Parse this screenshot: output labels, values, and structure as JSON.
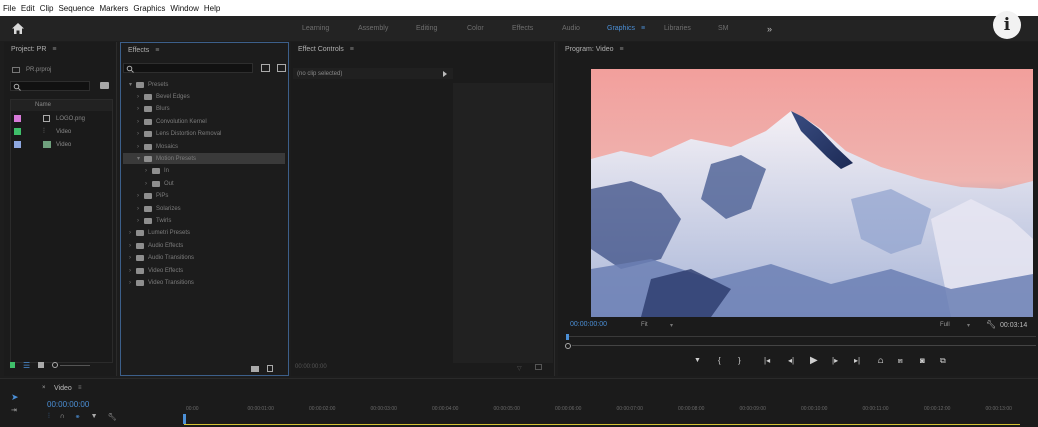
{
  "menubar": [
    "File",
    "Edit",
    "Clip",
    "Sequence",
    "Markers",
    "Graphics",
    "Window",
    "Help"
  ],
  "workspaces": {
    "tabs": [
      "Learning",
      "Assembly",
      "Editing",
      "Color",
      "Effects",
      "Audio",
      "Graphics",
      "Libraries",
      "SM"
    ],
    "active": "Graphics",
    "more": "»"
  },
  "info_button": "i",
  "project": {
    "title": "Project: PR",
    "file": "PR.prproj",
    "column_name": "Name",
    "items": [
      {
        "name": "LOGO.png",
        "color": "#d77ad9"
      },
      {
        "name": "Video",
        "color": "#3fbf6a"
      },
      {
        "name": "Video",
        "color": "#8ea8e0"
      }
    ]
  },
  "effects": {
    "title": "Effects",
    "tree": [
      {
        "label": "Presets",
        "level": 0
      },
      {
        "label": "Bevel Edges",
        "level": 1
      },
      {
        "label": "Blurs",
        "level": 1
      },
      {
        "label": "Convolution Kernel",
        "level": 1
      },
      {
        "label": "Lens Distortion Removal",
        "level": 1
      },
      {
        "label": "Mosaics",
        "level": 1
      },
      {
        "label": "Motion Presets",
        "level": 1,
        "selected": true
      },
      {
        "label": "In",
        "level": 2
      },
      {
        "label": "Out",
        "level": 2
      },
      {
        "label": "PiPs",
        "level": 1
      },
      {
        "label": "Solarizes",
        "level": 1
      },
      {
        "label": "Twirls",
        "level": 1
      },
      {
        "label": "Lumetri Presets",
        "level": 0
      },
      {
        "label": "Audio Effects",
        "level": 0
      },
      {
        "label": "Audio Transitions",
        "level": 0
      },
      {
        "label": "Video Effects",
        "level": 0
      },
      {
        "label": "Video Transitions",
        "level": 0
      }
    ]
  },
  "effect_controls": {
    "title": "Effect Controls",
    "no_clip": "(no clip selected)",
    "footer_time": "00:00:00:00"
  },
  "program": {
    "title": "Program: Video",
    "timecode": "00:00:00:00",
    "zoom": "Fit",
    "quality": "Full",
    "duration": "00:03:14"
  },
  "timeline": {
    "title": "Video",
    "timecode": "00:00:00:00",
    "ruler": [
      "00:00",
      "00:00:01:00",
      "00:00:02:00",
      "00:00:03:00",
      "00:00:04:00",
      "00:00:05:00",
      "00:00:06:00",
      "00:00:07:00",
      "00:00:08:00",
      "00:00:09:00",
      "00:00:10:00",
      "00:00:11:00",
      "00:00:12:00",
      "00:00:13:00"
    ]
  },
  "colors": {
    "accent": "#4b8fd6",
    "panel_border_active": "#3c5f8a",
    "play_cursor": "#d4c233"
  }
}
